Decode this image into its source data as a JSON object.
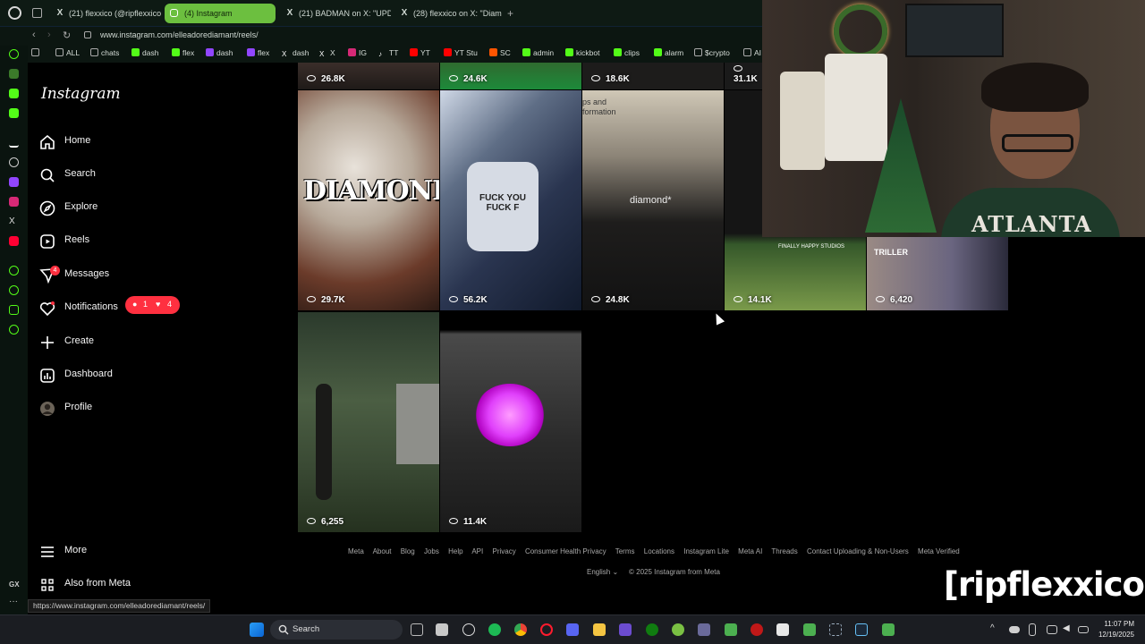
{
  "browser": {
    "tabs": [
      {
        "label": "(21) flexxico (@ripflexxico",
        "icon": "x-icon",
        "active": false
      },
      {
        "label": "(4) Instagram",
        "icon": "instagram-icon",
        "active": true
      },
      {
        "label": "(21) BADMAN on X: \"UPD",
        "icon": "x-icon",
        "active": false
      },
      {
        "label": "(28) flexxico on X: \"Diam",
        "icon": "x-icon",
        "active": false
      }
    ],
    "url": "www.instagram.com/elleadorediamant/reels/",
    "bookmarks": [
      "ALL",
      "chats",
      "dash",
      "flex",
      "dash",
      "flex",
      "dash",
      "X",
      "IG",
      "TT",
      "YT",
      "YT Stu",
      "SC",
      "admin",
      "kickbot",
      "clips",
      "alarm",
      "$crypto",
      "AI"
    ],
    "status_url": "https://www.instagram.com/elleadorediamant/reels/"
  },
  "instagram": {
    "logo": "Instagram",
    "nav": [
      {
        "label": "Home",
        "icon": "home-icon"
      },
      {
        "label": "Search",
        "icon": "search-icon"
      },
      {
        "label": "Explore",
        "icon": "explore-icon"
      },
      {
        "label": "Reels",
        "icon": "reels-icon"
      },
      {
        "label": "Messages",
        "icon": "messages-icon"
      },
      {
        "label": "Notifications",
        "icon": "heart-icon"
      },
      {
        "label": "Create",
        "icon": "plus-icon"
      },
      {
        "label": "Dashboard",
        "icon": "dashboard-icon"
      },
      {
        "label": "Profile",
        "icon": "avatar"
      }
    ],
    "messages_badge": "4",
    "notif_bubble": {
      "comments": "1",
      "likes": "4"
    },
    "more": "More",
    "also_from_meta": "Also from Meta",
    "reels": [
      {
        "views": "26.8K",
        "caption": ""
      },
      {
        "views": "24.6K",
        "caption": ""
      },
      {
        "views": "18.6K",
        "caption": "ps and formation"
      },
      {
        "views": "31.1K",
        "caption": ""
      },
      {
        "views": "29.7K",
        "caption": "DIAMOND*"
      },
      {
        "views": "56.2K",
        "caption": "FUCK YOU FUCK F"
      },
      {
        "views": "24.8K",
        "caption": "diamond*"
      },
      {
        "views": "14.1K",
        "caption": "FINALLY HAPPY STUDIOS"
      },
      {
        "views": "6,420",
        "caption": "TRILLER"
      },
      {
        "views": "6,255",
        "caption": ""
      },
      {
        "views": "11.4K",
        "caption": ""
      }
    ],
    "footer": {
      "links": [
        "Meta",
        "About",
        "Blog",
        "Jobs",
        "Help",
        "API",
        "Privacy",
        "Consumer Health Privacy",
        "Terms",
        "Locations",
        "Instagram Lite",
        "Meta AI",
        "Threads",
        "Contact Uploading & Non-Users",
        "Meta Verified"
      ],
      "language": "English",
      "copyright": "© 2025 Instagram from Meta"
    }
  },
  "overlay": {
    "streamer_tag": "[ripflexxico]",
    "shirt_text": "ATLANTA"
  },
  "taskbar": {
    "search_label": "Search",
    "time": "11:07 PM",
    "date": "12/19/2025"
  }
}
